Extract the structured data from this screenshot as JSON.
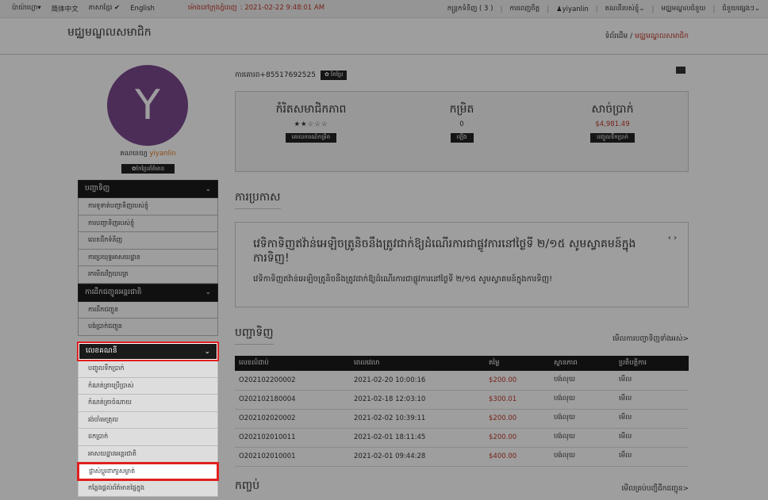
{
  "topbar": {
    "lang_khmer": "ប៉ាយ៉ាហ្គោ",
    "lang_chinese": "简体中文",
    "lang_khmer2": "ភាសាខ្មែរ",
    "lang_english": "English",
    "notice_label": "ម៉ោងនៅក្រុងភ្នំពេញ",
    "notice_time": ": 2021-02-22 9:48:01 AM",
    "cart": "កន្ត្រកទំនិញ ( 3 )",
    "favorites": "ការពេញចិត្ត",
    "username": "yiyanlin",
    "my_account": "គណនីរបស់ខ្ញុំ",
    "member_center": "មជ្ឈមណ្ឌលជំនួយ",
    "more": "ជំនួយផ្សេងៗ"
  },
  "header": {
    "title": "មជ្ឈមណ្ឌលសមាជិក",
    "crumb_home": "ទំព័រដើម",
    "crumb_sep": "/",
    "crumb_current": "មជ្ឈមណ្ឌលសមាជិក"
  },
  "profile": {
    "avatar_letter": "Y",
    "name_label": "គណនេយ្យ",
    "name": "yiyanlin",
    "edit_label": "✿កែប្រែព័ត៌មាន"
  },
  "menu": {
    "section1": "បញ្ជាទិញ",
    "s1_items": [
      "ការទូទាត់បញ្ជាទិញរបស់ខ្ញុំ",
      "ការបញ្ជាទិញរបស់ខ្ញុំ",
      "លេខដឹកទំនិញ",
      "ការប្រយុទ្ធអាសយដ្ឋាន",
      "រកមើលវិក្កយបត្រ"
    ],
    "section2": "ការដឹកជញ្ជូនអន្តរជាតិ",
    "s2_items": [
      "ការដឹកជញ្ជូន",
      "បង់ប្រាក់ជញ្ជូន"
    ],
    "section3": "លេខគណនី",
    "s3_items": [
      "បញ្ចូលទឹកប្រាក់",
      "កំណត់ត្រាប្រើប្រាស់",
      "កំណត់ត្រាចំណាយ",
      "រង់ចាំមេត្រុល",
      "ដកប្រាក់",
      "អាសយដ្ឋានអន្តរជាតិ",
      "ផ្លាស់ប្តូរពាក្យសម្ងាត់",
      "កន្លែងផ្តល់ព័ត៌មានផ្ទៃក្នុង"
    ]
  },
  "contact": {
    "phone_label": "ការគោរព",
    "phone": "+85517692525",
    "edit": "✿ កែប្រែ"
  },
  "stats": [
    {
      "title": "កំរិតសមាជិកភាព",
      "value": "★★☆☆☆",
      "button": "គោលការណ៍កម្រិត"
    },
    {
      "title": "កម្រិត",
      "value": "0",
      "button": "ឡើង"
    },
    {
      "title": "សាច់ប្រាក់",
      "value": "$4,981.49",
      "button": "បញ្ចូលទឹកប្រាក់"
    }
  ],
  "announcement": {
    "section_title": "ការប្រកាស",
    "headline": "វេទិកាទិញឥវ៉ាន់អេឡិចត្រូនិចនឹងត្រូវជាក់ឱ្យដំណើរការជាផ្លូវការនៅថ្ងៃទី ២/១៥ សូមស្វាគមន៍ក្នុងការទិញ!",
    "body": "វេទិកាទិញឥវ៉ាន់អេឡិចត្រូនិចនឹងត្រូវដាក់ឱ្យដំណើរការជាផ្លូវការនៅថ្ងៃទី ២/១៥ សូមស្វាគមន៍ក្នុងការទិញ!",
    "nav": "‹ ›"
  },
  "orders": {
    "section_title": "បញ្ជាទិញ",
    "view_all": "មើលការបញ្ជាទិញទាំងអស់>",
    "columns": [
      "លេខលំដាប់",
      "ពេលវេលា",
      "តម្លៃ",
      "ស្ថានភាព",
      "ប្រតិបត្តិការ"
    ],
    "rows": [
      [
        "O202102200002",
        "2021-02-20 10:00:16",
        "$200.00",
        "បង់លុយ",
        "មើល"
      ],
      [
        "O202102180004",
        "2021-02-18 12:03:10",
        "$300.01",
        "បង់លុយ",
        "មើល"
      ],
      [
        "O202102020002",
        "2021-02-02 10:39:11",
        "$200.00",
        "បង់លុយ",
        "មើល"
      ],
      [
        "O202102010011",
        "2021-02-01 18:11:45",
        "$200.00",
        "បង់លុយ",
        "មើល"
      ],
      [
        "O202102010001",
        "2021-02-01 09:44:28",
        "$400.00",
        "បង់លុយ",
        "មើល"
      ]
    ]
  },
  "bottom": {
    "title": "កញ្ចប់",
    "view_all": "មើលគ្រប់បញ្ជីដឹកជញ្ជូន>"
  }
}
